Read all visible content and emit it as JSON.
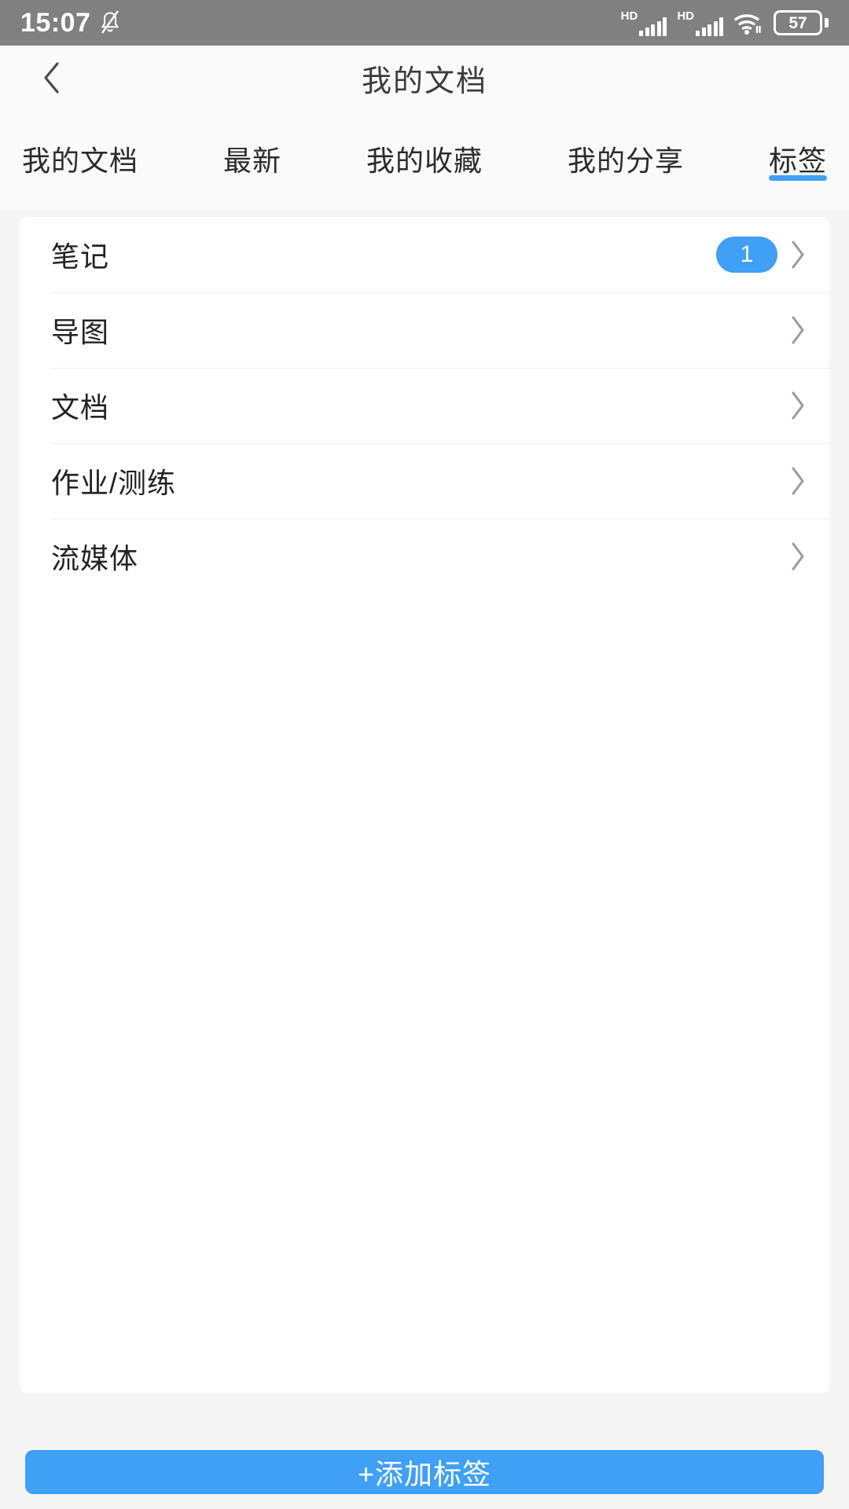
{
  "status_bar": {
    "time": "15:07",
    "mute_icon": "bell-muted-icon",
    "sim1": {
      "label": "HD",
      "icon": "signal-bars-icon",
      "bars": 5
    },
    "sim2": {
      "label": "HD",
      "icon": "signal-bars-icon",
      "bars": 5
    },
    "wifi_icon": "wifi-icon",
    "battery": {
      "level": "57",
      "icon": "battery-icon"
    }
  },
  "header": {
    "title": "我的文档",
    "back_icon": "back-chevron-icon"
  },
  "tabs": [
    {
      "label": "我的文档",
      "active": false
    },
    {
      "label": "最新",
      "active": false
    },
    {
      "label": "我的收藏",
      "active": false
    },
    {
      "label": "我的分享",
      "active": false
    },
    {
      "label": "标签",
      "active": true
    }
  ],
  "list": {
    "rows": [
      {
        "label": "笔记",
        "badge": "1",
        "chevron_icon": "chevron-right-icon"
      },
      {
        "label": "导图",
        "badge": "",
        "chevron_icon": "chevron-right-icon"
      },
      {
        "label": "文档",
        "badge": "",
        "chevron_icon": "chevron-right-icon"
      },
      {
        "label": "作业/测练",
        "badge": "",
        "chevron_icon": "chevron-right-icon"
      },
      {
        "label": "流媒体",
        "badge": "",
        "chevron_icon": "chevron-right-icon"
      }
    ]
  },
  "footer": {
    "add_label": "+添加标签"
  },
  "colors": {
    "accent": "#3fa0f5",
    "statusbar_bg": "#808080",
    "page_bg": "#f5f5f5",
    "card_bg": "#ffffff",
    "text_primary": "#222222",
    "divider": "#ededed"
  }
}
